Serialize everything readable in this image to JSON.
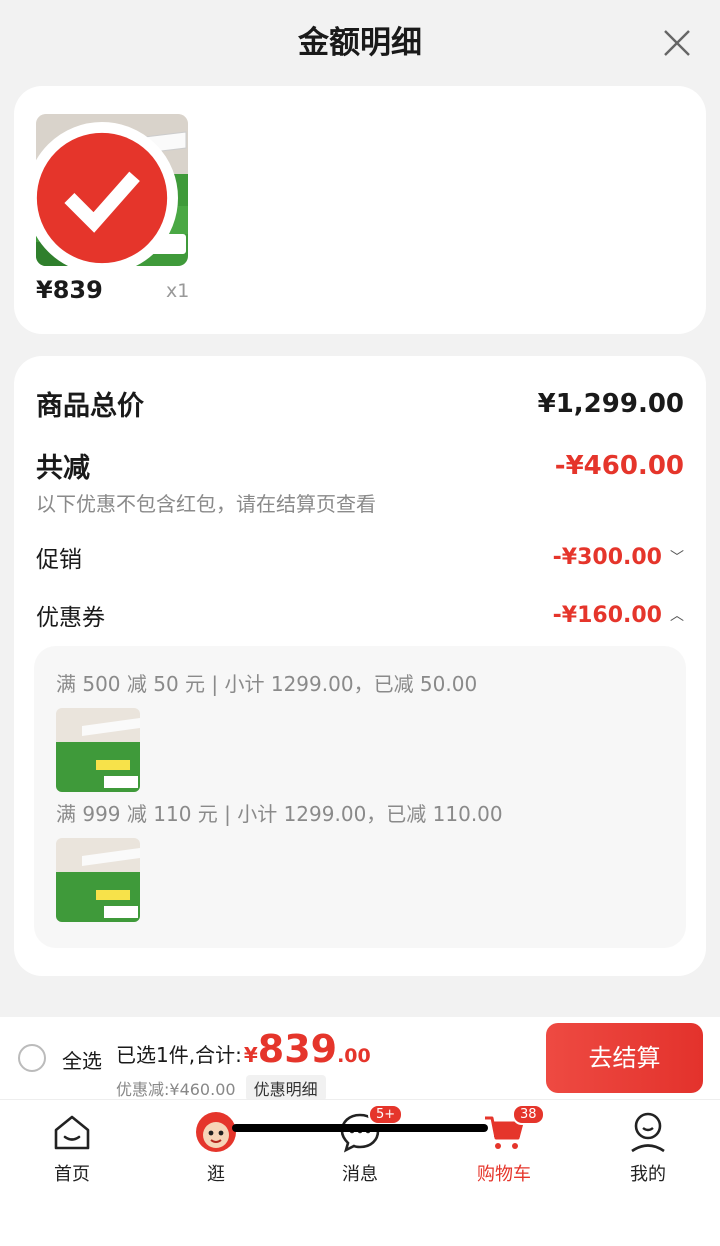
{
  "header": {
    "title": "金额明细"
  },
  "product": {
    "price": "¥839",
    "quantity": "x1"
  },
  "detail": {
    "total_label": "商品总价",
    "total_value": "¥1,299.00",
    "reduce_label": "共减",
    "reduce_value": "-¥460.00",
    "note": "以下优惠不包含红包，请在结算页查看",
    "promo_label": "促销",
    "promo_value": "-¥300.00",
    "coupon_label": "优惠券",
    "coupon_value": "-¥160.00",
    "coupons": [
      {
        "text": "满 500 减 50 元 | 小计 1299.00，已减 50.00"
      },
      {
        "text": "满 999 减 110 元 | 小计 1299.00，已减 110.00"
      }
    ]
  },
  "bottom_bar": {
    "select_all": "全选",
    "selected": "已选1件,合计:",
    "currency": "¥",
    "total_int": "839",
    "total_dec": ".00",
    "discount": "优惠减:¥460.00",
    "detail_chip": "优惠明细",
    "checkout": "去结算"
  },
  "tabs": [
    {
      "label": "首页",
      "icon": "home-icon"
    },
    {
      "label": "逛",
      "icon": "mascot-icon"
    },
    {
      "label": "消息",
      "icon": "message-icon",
      "badge": "5+"
    },
    {
      "label": "购物车",
      "icon": "cart-icon",
      "badge": "38"
    },
    {
      "label": "我的",
      "icon": "profile-icon"
    }
  ],
  "colors": {
    "accent": "#e5352b",
    "product_green": "#3f9a3a"
  }
}
